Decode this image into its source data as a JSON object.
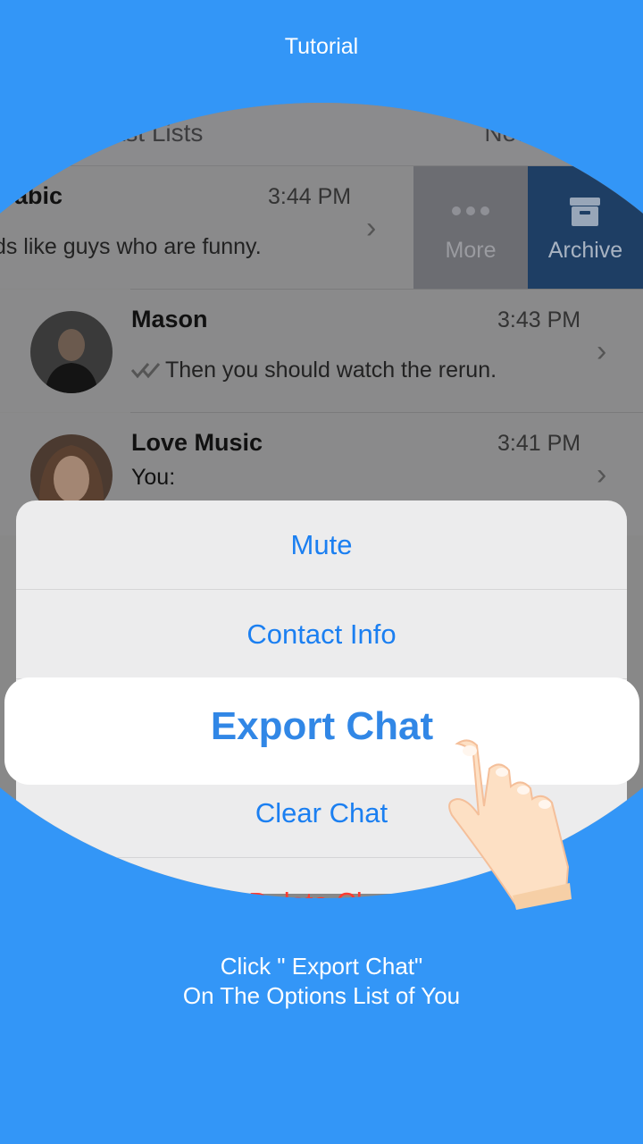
{
  "header": {
    "title": "Tutorial"
  },
  "chat_list": {
    "broadcast_label": "Broadcast Lists",
    "new_group_label": "New Group",
    "chats": [
      {
        "name": "Arabic",
        "time": "3:44 PM",
        "message": "Ids like guys who are funny."
      },
      {
        "name": "Mason",
        "time": "3:43 PM",
        "message": "Then you should watch the rerun."
      },
      {
        "name": "Love Music",
        "time": "3:41 PM",
        "message": "You:"
      }
    ],
    "swipe": {
      "more_label": "More",
      "archive_label": "Archive"
    }
  },
  "sheet": {
    "mute": "Mute",
    "contact_info": "Contact Info",
    "export_chat": "Export Chat",
    "clear_chat": "Clear Chat",
    "delete_chat": "Delete Chat"
  },
  "instruction": {
    "line1": "Click \" Export Chat\"",
    "line2": "On The Options List of You"
  },
  "colors": {
    "background": "#3396f7",
    "accent": "#1b7ff1",
    "archive": "#1e3e64",
    "delete": "#ff3b30"
  }
}
